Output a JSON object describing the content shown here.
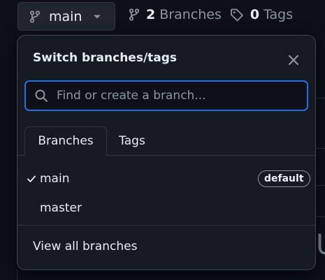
{
  "topbar": {
    "branch_button_label": "main",
    "branches_count": "2",
    "branches_label": "Branches",
    "tags_count": "0",
    "tags_label": "Tags"
  },
  "dropdown": {
    "title": "Switch branches/tags",
    "search_placeholder": "Find or create a branch...",
    "tabs": [
      {
        "label": "Branches",
        "active": true
      },
      {
        "label": "Tags",
        "active": false
      }
    ],
    "branches": [
      {
        "name": "main",
        "selected": true,
        "badge": "default"
      },
      {
        "name": "master",
        "selected": false,
        "badge": ""
      }
    ],
    "footer_link": "View all branches"
  },
  "icons": {
    "branch": "git-branch-icon",
    "caret": "chevron-down-icon",
    "tag": "tag-icon",
    "close": "close-icon",
    "search": "search-icon",
    "check": "check-icon"
  },
  "colors": {
    "background": "#0d1117",
    "panel": "#161b22",
    "accent_focus": "#1f6feb",
    "text": "#e6edf3",
    "muted": "#8b949e"
  }
}
